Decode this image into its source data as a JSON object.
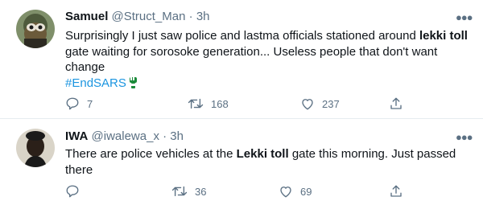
{
  "tweets": [
    {
      "name": "Samuel",
      "handle": "@Struct_Man",
      "separator": "·",
      "time": "3h",
      "text_before": "Surprisingly I just saw police and lastma officials stationed around ",
      "text_bold": "lekki toll",
      "text_after": " gate waiting for sorosoke generation... Useless people that don't want change",
      "hashtag": "#EndSARS",
      "replies": "7",
      "retweets": "168",
      "likes": "237"
    },
    {
      "name": "IWA",
      "handle": "@iwalewa_x",
      "separator": "·",
      "time": "3h",
      "text_before": "There are police vehicles at the ",
      "text_bold": "Lekki toll",
      "text_after": " gate this morning. Just passed there",
      "replies": "",
      "retweets": "36",
      "likes": "69"
    }
  ],
  "icons": {
    "more": "more-dots-icon",
    "reply": "reply-icon",
    "retweet": "retweet-icon",
    "like": "heart-icon",
    "share": "share-icon",
    "emoji": "raised-fist-icon"
  },
  "colors": {
    "text": "#0f1419",
    "secondary": "#5b7083",
    "link": "#1b95e0",
    "divider": "#e6ecf0"
  }
}
